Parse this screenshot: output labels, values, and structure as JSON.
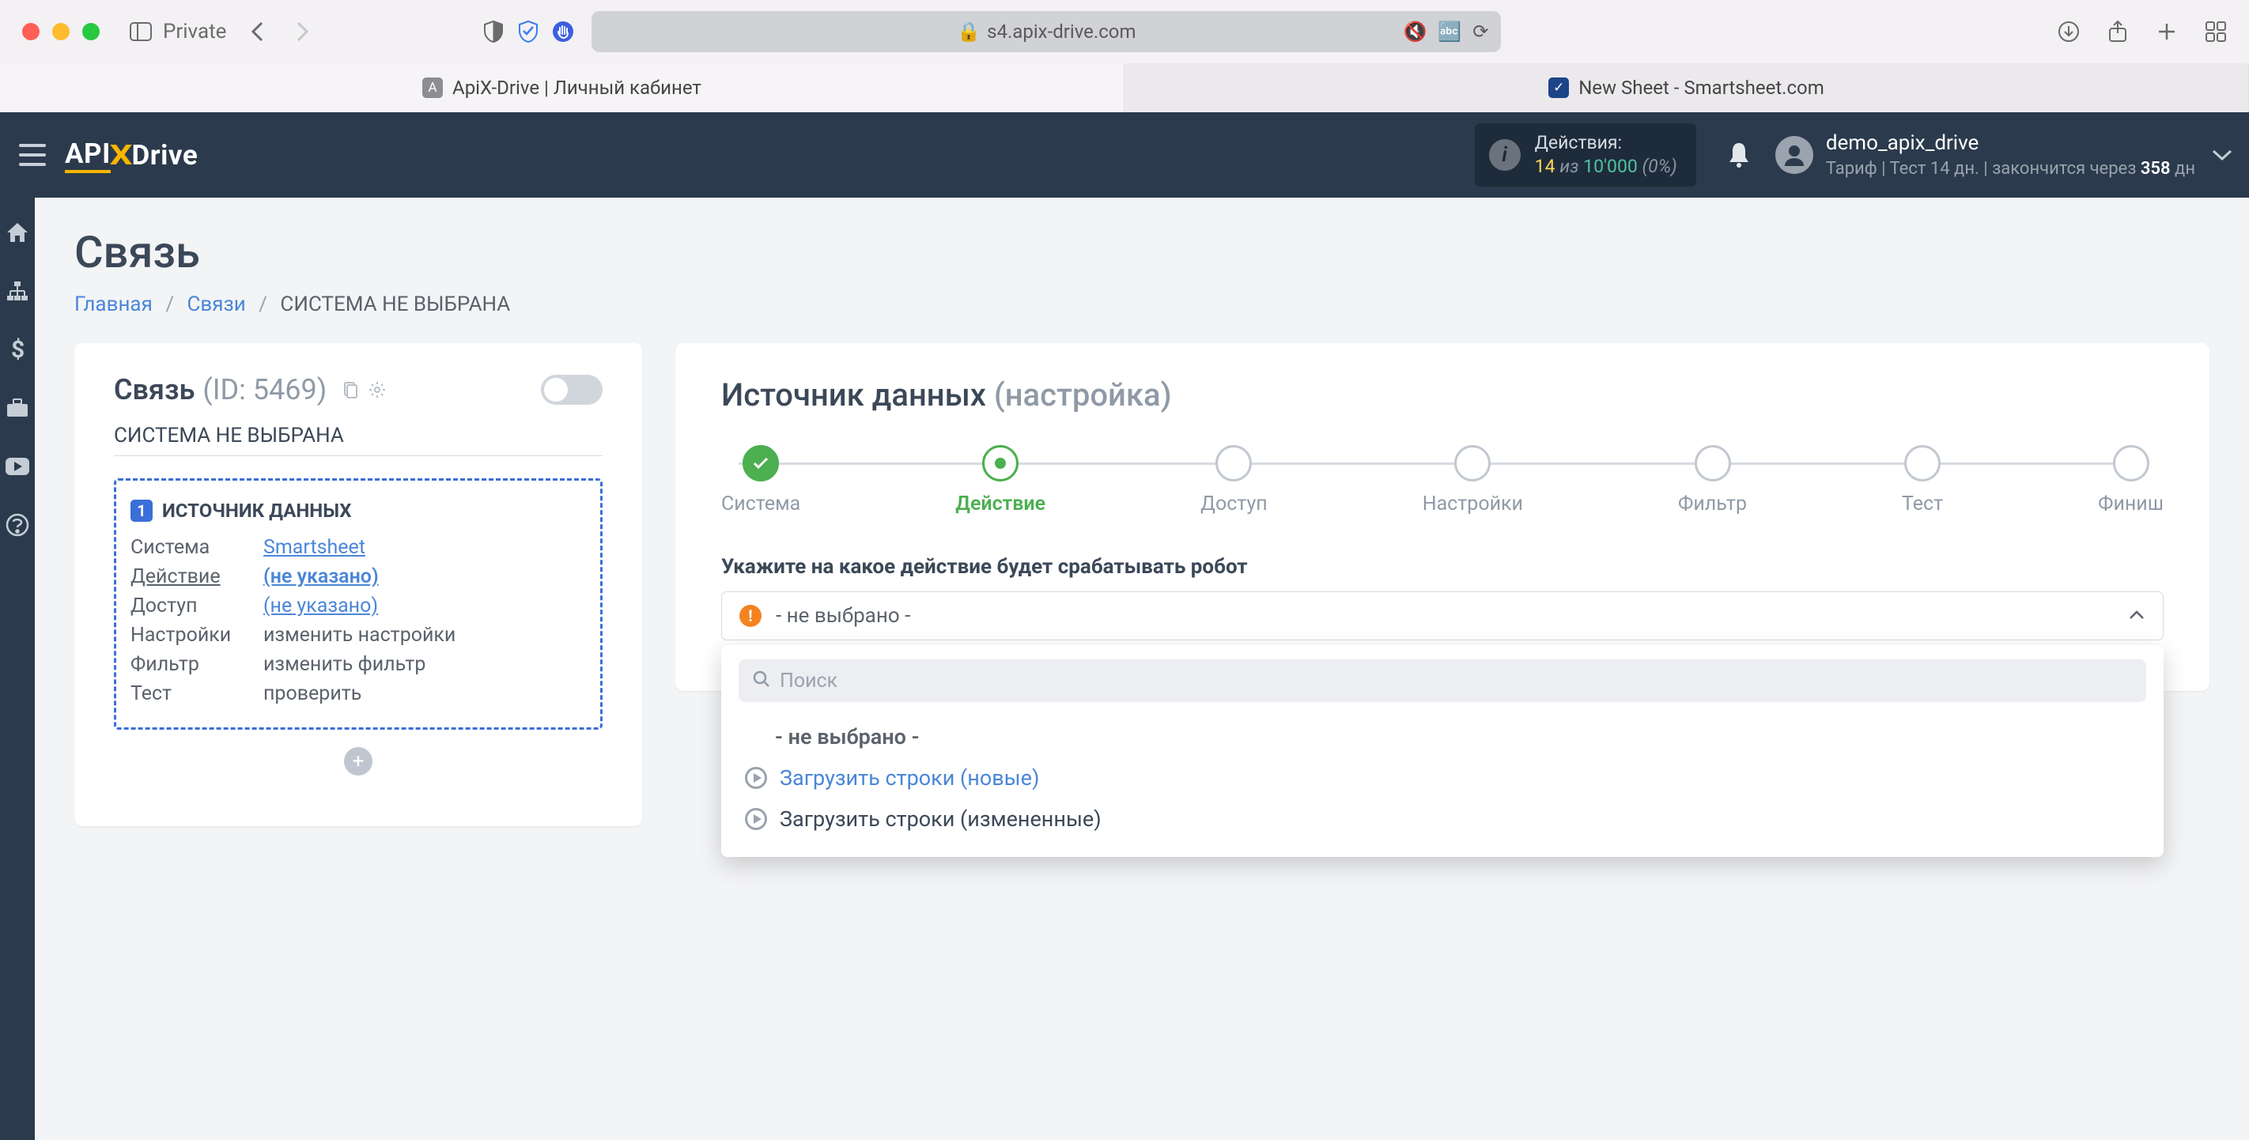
{
  "browser": {
    "private_label": "Private",
    "url_domain": "s4.apix-drive.com",
    "tabs": [
      {
        "favicon": "A",
        "title": "ApiX-Drive | Личный кабинет"
      },
      {
        "favicon": "S",
        "title": "New Sheet - Smartsheet.com"
      }
    ]
  },
  "header": {
    "logo_api": "API",
    "logo_x": "X",
    "logo_drive": "Drive",
    "actions_label": "Действия:",
    "actions_used": "14",
    "actions_of": "из",
    "actions_total": "10'000",
    "actions_pct": "(0%)",
    "username": "demo_apix_drive",
    "tariff_prefix": "Тариф | Тест 14 дн. | закончится через ",
    "tariff_days": "358",
    "tariff_suffix": " дн"
  },
  "page": {
    "title": "Связь",
    "breadcrumb": {
      "home": "Главная",
      "links": "Связи",
      "current": "СИСТЕМА НЕ ВЫБРАНА"
    }
  },
  "left_card": {
    "title": "Связь",
    "id_label": "(ID: 5469)",
    "system_none": "СИСТЕМА НЕ ВЫБРАНА",
    "source_badge": "1",
    "source_title": "ИСТОЧНИК ДАННЫХ",
    "rows": {
      "system": {
        "k": "Система",
        "v": "Smartsheet"
      },
      "action": {
        "k": "Действие",
        "v": "(не указано)"
      },
      "access": {
        "k": "Доступ",
        "v": "(не указано)"
      },
      "settings": {
        "k": "Настройки",
        "v": "изменить настройки"
      },
      "filter": {
        "k": "Фильтр",
        "v": "изменить фильтр"
      },
      "test": {
        "k": "Тест",
        "v": "проверить"
      }
    }
  },
  "right_card": {
    "title": "Источник данных",
    "subtitle": "(настройка)",
    "steps": [
      "Система",
      "Действие",
      "Доступ",
      "Настройки",
      "Фильтр",
      "Тест",
      "Финиш"
    ],
    "field_label": "Укажите на какое действие будет срабатывать робот",
    "selected_text": "- не выбрано -",
    "search_placeholder": "Поиск",
    "options": {
      "placeholder": "- не выбрано -",
      "opt1": "Загрузить строки (новые)",
      "opt2": "Загрузить строки (измененные)"
    }
  }
}
